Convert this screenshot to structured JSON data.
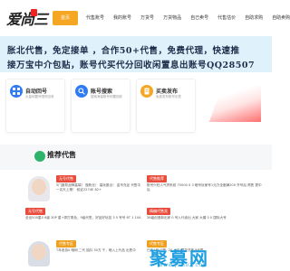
{
  "header": {
    "logo_text": "爱尚三",
    "nav": [
      {
        "label": "首页",
        "active": true
      },
      {
        "label": "代售账号"
      },
      {
        "label": "我的账号"
      },
      {
        "label": "万货号"
      },
      {
        "label": "万货物品"
      },
      {
        "label": "自己卖号"
      },
      {
        "label": "代售估价"
      },
      {
        "label": "自助求购"
      },
      {
        "label": "自助卖购"
      }
    ]
  },
  "banner": {
    "line1": "胀北代售，免定接单 ，合作50+代售，免费代理，快速推",
    "line2": "接万宝中介包贴，账号代买代分回收闲置息出账号QQ28507"
  },
  "cards": [
    {
      "title": "自动回号",
      "desc": "大量闲置号限时回收",
      "icon_color": "#2f7bf5",
      "icon": "grid-icon"
    },
    {
      "title": "账号搜索",
      "desc": "搜索海量账号闲置回收",
      "icon_color": "#2f7bf5",
      "icon": "search-icon"
    },
    {
      "title": "买卖发布",
      "desc": "免费发布账号出售",
      "icon_color": "#f5a623",
      "icon": "document-icon"
    }
  ],
  "section": {
    "title": "推荐代售"
  },
  "listings": {
    "left": [
      {
        "tag": "无号代售",
        "tag_color": "red",
        "text": "5门魔导战神高端！ 做粉丝！ 高玩推出！ 金币充足 代售中一名天上第！ 权证2274E 82+"
      },
      {
        "tag": "无号代售",
        "tag_color": "red",
        "text": "全出500星0 6级 30P 星+秀打角色，9级代售，好品好玩挂 3 5 号号 6T 1 10A"
      },
      {
        "tag": "代售专区",
        "tag_color": "orange",
        "text": "T年老游0 暗网 二代 抽抖 30万 千，暗入上代品 出售中"
      }
    ],
    "right": [
      {
        "tag": "代售推荐",
        "tag_color": "red",
        "text": "账号兴旺人气拼系统 75000 0 3 暗号玩家号1元万全服满200 开号后 再售 提中后"
      },
      {
        "tag": "精编代售卖",
        "tag_color": "red",
        "text": "38级创造新出家 0 号入代卖出 大家 大帽 0 0 国际大号"
      },
      {
        "tag": "代售专区",
        "tag_color": "orange",
        "text": "已有1号 已售: 20 4 级 限量兑换 9代售"
      }
    ]
  },
  "watermark": {
    "main": "聚募网",
    "sub": "WWW.JUMUZ.COM"
  }
}
